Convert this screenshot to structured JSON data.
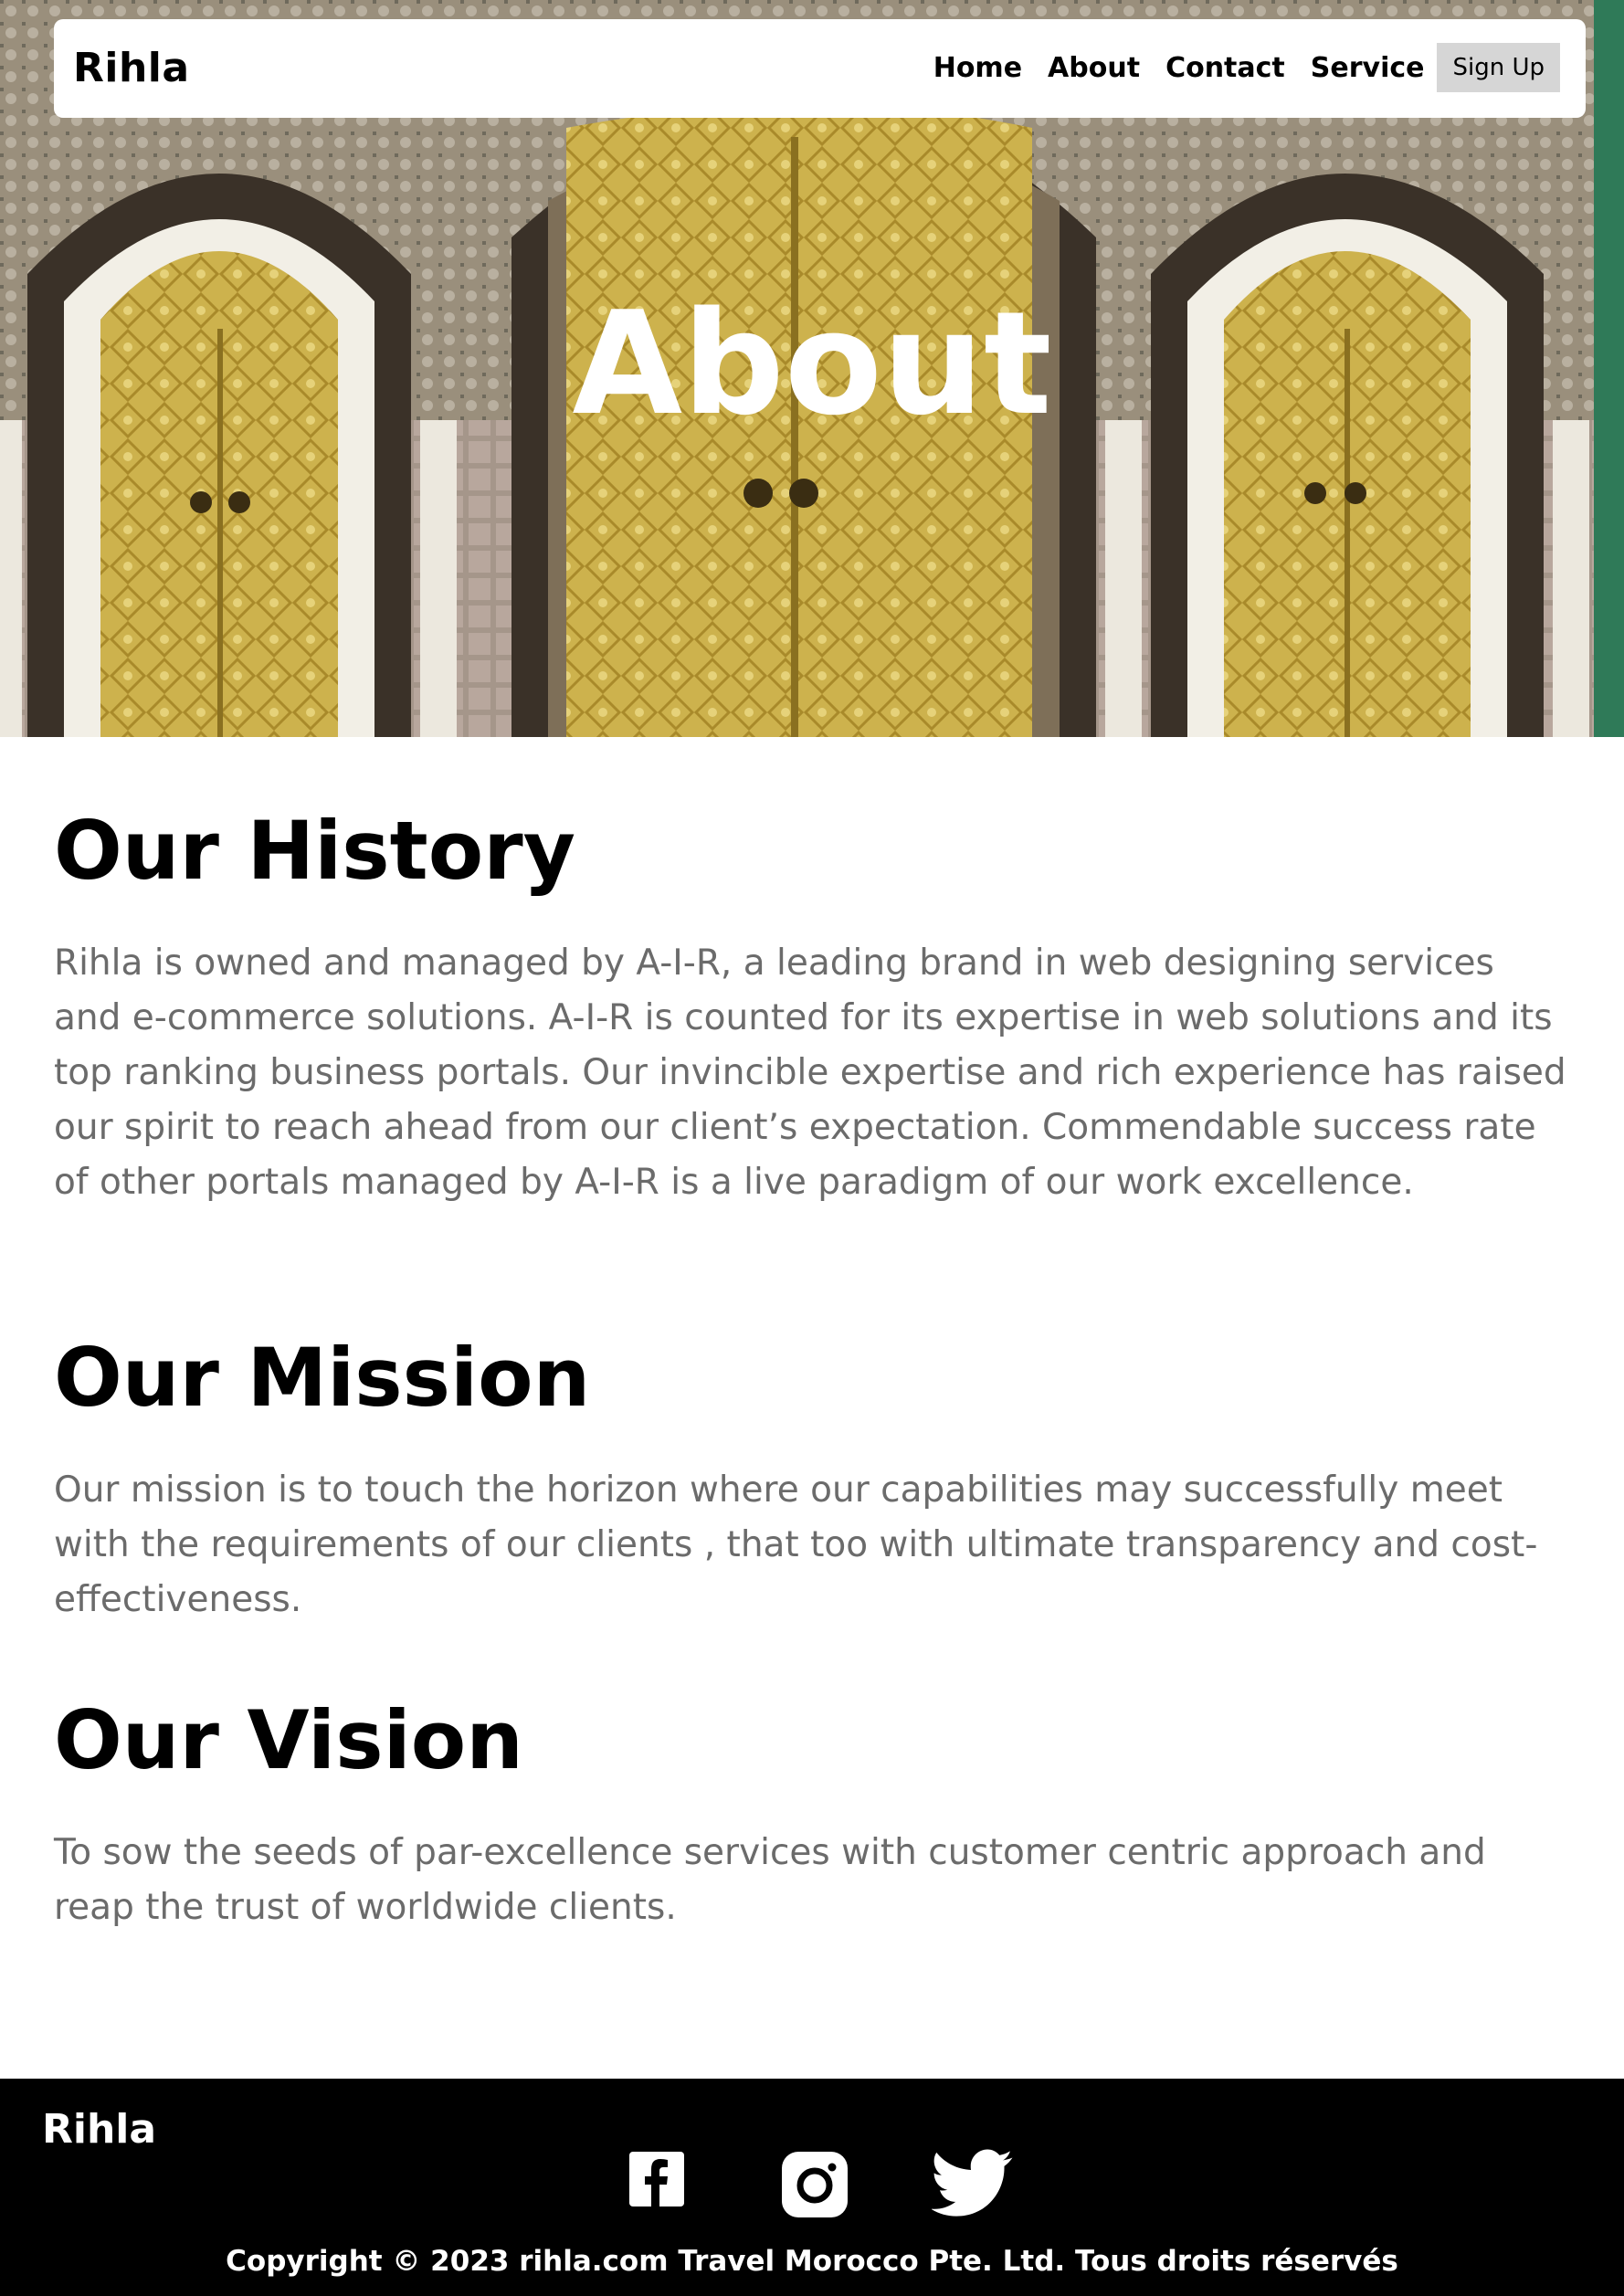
{
  "nav": {
    "brand": "Rihla",
    "links": [
      "Home",
      "About",
      "Contact",
      "Service"
    ],
    "signup": "Sign Up"
  },
  "hero": {
    "title": "About",
    "image": "moroccan-palace-gold-doors"
  },
  "sections": [
    {
      "title": "Our History",
      "text": "Rihla is owned and managed by A-I-R, a leading brand in web designing services and e-commerce solutions. A-I-R is counted for its expertise in web solutions and its top ranking business portals. Our invincible expertise and rich experience has raised our spirit to reach ahead from our client’s expectation. Commendable success rate of other portals managed by A-I-R is a live paradigm of our work excellence."
    },
    {
      "title": "Our Mission",
      "text": "Our mission is to touch the horizon where our capabilities may successfully meet with the requirements of our clients , that too with ultimate transparency and cost-effectiveness."
    },
    {
      "title": "Our Vision",
      "text": "To sow the seeds of par-excellence services with customer centric approach and reap the trust of worldwide clients."
    }
  ],
  "footer": {
    "brand": "Rihla",
    "social": [
      "facebook-icon",
      "instagram-icon",
      "twitter-icon"
    ],
    "copyright": "Copyright © 2023 rihla.com Travel Morocco Pte. Ltd. Tous droits réservés"
  },
  "colors": {
    "footer_bg": "#000000",
    "body_text": "#6b6b6b",
    "signup_bg": "#d6d6d6",
    "gold": "#c9b04a"
  }
}
